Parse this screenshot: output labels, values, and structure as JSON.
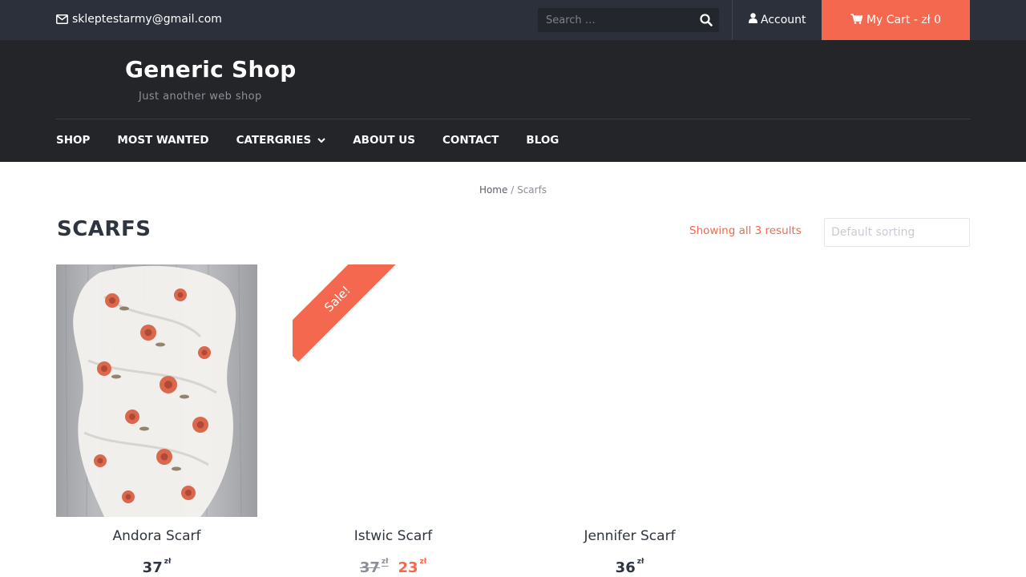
{
  "topbar": {
    "email": "skleptestarmy@gmail.com",
    "search_placeholder": "Search …",
    "account_label": "Account",
    "cart_label": "My Cart - zł 0"
  },
  "header": {
    "site_title": "Generic Shop",
    "tagline": "Just another web shop"
  },
  "nav": {
    "items": [
      {
        "label": "SHOP"
      },
      {
        "label": "MOST WANTED"
      },
      {
        "label": "CATERGRIES"
      },
      {
        "label": "ABOUT US"
      },
      {
        "label": "CONTACT"
      },
      {
        "label": "BLOG"
      }
    ]
  },
  "breadcrumb": {
    "home": "Home",
    "separator": "/",
    "current": "Scarfs"
  },
  "page": {
    "title": "SCARFS",
    "result_count": "Showing all 3 results",
    "sort_placeholder": "Default sorting"
  },
  "products": [
    {
      "name": "Andora Scarf",
      "price": "37",
      "currency": "zł",
      "on_sale": false
    },
    {
      "name": "Istwic Scarf",
      "old_price": "37",
      "price": "23",
      "currency": "zł",
      "on_sale": true,
      "badge": "Sale!"
    },
    {
      "name": "Jennifer Scarf",
      "price": "36",
      "currency": "zł",
      "on_sale": false
    }
  ],
  "colors": {
    "accent": "#f3684f",
    "topbar_bg": "#2c303a",
    "header_bg": "#232529",
    "text_dark": "#2e3540"
  },
  "icons": {
    "email": "envelope-icon",
    "search": "search-icon",
    "account": "user-icon",
    "cart": "cart-icon",
    "dropdown": "chevron-down-icon"
  }
}
